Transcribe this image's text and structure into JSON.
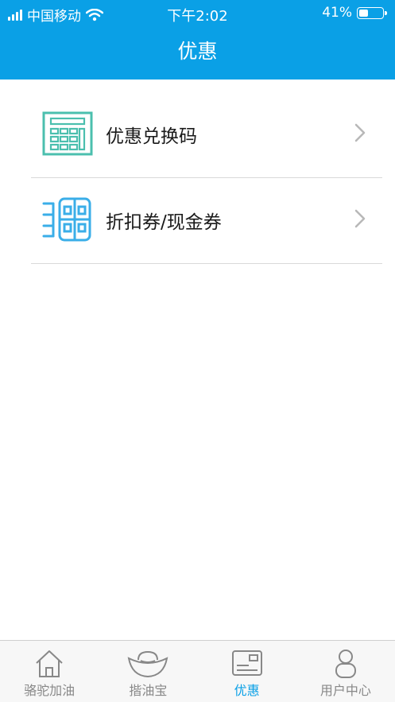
{
  "status_bar": {
    "carrier": "中国移动",
    "time": "下午2:02",
    "battery_text": "41%",
    "battery_level": 0.41
  },
  "header": {
    "title": "优惠"
  },
  "menu": {
    "items": [
      {
        "label": "优惠兑换码",
        "icon": "calculator-icon"
      },
      {
        "label": "折扣券/现金券",
        "icon": "coupon-grid-icon"
      }
    ]
  },
  "tab_bar": {
    "tabs": [
      {
        "label": "骆驼加油",
        "icon": "home-icon",
        "active": false
      },
      {
        "label": "揩油宝",
        "icon": "ingot-icon",
        "active": false
      },
      {
        "label": "优惠",
        "icon": "card-icon",
        "active": true
      },
      {
        "label": "用户中心",
        "icon": "user-icon",
        "active": false
      }
    ]
  },
  "colors": {
    "accent": "#0aa0e6",
    "icon_teal": "#4bbfae",
    "icon_blue": "#3aaee8",
    "inactive": "#888888"
  }
}
